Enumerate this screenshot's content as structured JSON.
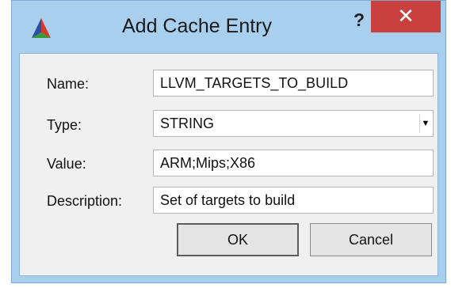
{
  "window": {
    "title": "Add Cache Entry",
    "help_label": "?",
    "close_label": "✕"
  },
  "form": {
    "name": {
      "label": "Name:",
      "value": "LLVM_TARGETS_TO_BUILD"
    },
    "type": {
      "label": "Type:",
      "value": "STRING"
    },
    "value": {
      "label": "Value:",
      "value": "ARM;Mips;X86"
    },
    "description": {
      "label": "Description:",
      "value": "Set of targets to build"
    }
  },
  "buttons": {
    "ok_label": "OK",
    "cancel_label": "Cancel"
  },
  "colors": {
    "title_bar": "#a9cfee",
    "close_button": "#c9403e",
    "client_area": "#f0f0f0"
  },
  "icons": {
    "app": "cmake-triangle-icon",
    "dropdown": "dropdown-arrow-icon"
  }
}
